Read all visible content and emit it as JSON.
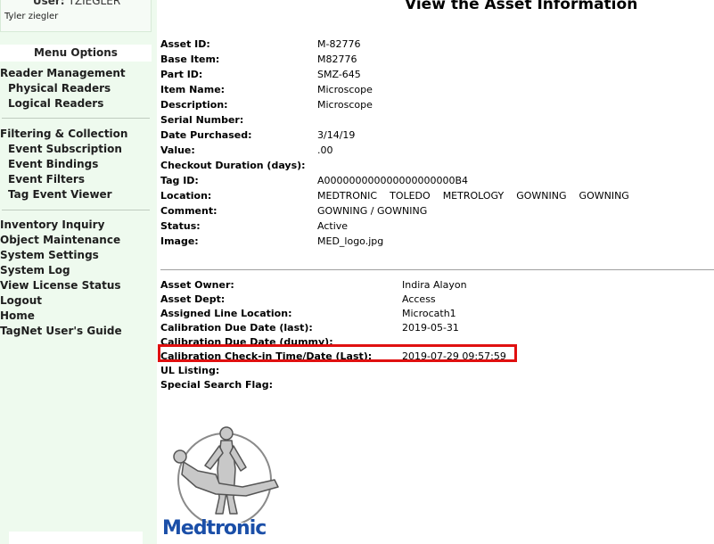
{
  "sidebar": {
    "user_label": "User:",
    "user_value": "TZIEGLER",
    "user_full_name": "Tyler ziegler",
    "menu_title": "Menu Options",
    "group1": [
      {
        "label": "Reader Management",
        "sub": false
      },
      {
        "label": "Physical Readers",
        "sub": true
      },
      {
        "label": "Logical Readers",
        "sub": true
      }
    ],
    "group2": [
      {
        "label": "Filtering & Collection",
        "sub": false
      },
      {
        "label": "Event Subscription",
        "sub": true
      },
      {
        "label": "Event Bindings",
        "sub": true
      },
      {
        "label": "Event Filters",
        "sub": true
      },
      {
        "label": "Tag Event Viewer",
        "sub": true
      }
    ],
    "group3": [
      {
        "label": "Inventory Inquiry"
      },
      {
        "label": "Object Maintenance"
      },
      {
        "label": "System Settings"
      },
      {
        "label": "System Log"
      },
      {
        "label": "View License Status"
      },
      {
        "label": "Logout"
      },
      {
        "label": "Home"
      },
      {
        "label": "TagNet User's Guide"
      }
    ]
  },
  "main": {
    "title": "View the Asset Information",
    "asset_fields": [
      {
        "label": "Asset ID:",
        "value": "M-82776"
      },
      {
        "label": "Base Item:",
        "value": "M82776"
      },
      {
        "label": "Part ID:",
        "value": "SMZ-645"
      },
      {
        "label": "Item Name:",
        "value": "Microscope"
      },
      {
        "label": "Description:",
        "value": "Microscope"
      },
      {
        "label": "Serial Number:",
        "value": ""
      },
      {
        "label": "Date Purchased:",
        "value": "3/14/19"
      },
      {
        "label": "Value:",
        "value": ".00"
      },
      {
        "label": "Checkout Duration (days):",
        "value": ""
      },
      {
        "label": "Tag ID:",
        "value": "A000000000000000000000B4"
      },
      {
        "label": "Location:",
        "value": "",
        "parts": [
          "MEDTRONIC",
          "TOLEDO",
          "METROLOGY",
          "GOWNING",
          "GOWNING"
        ]
      },
      {
        "label": "Comment:",
        "value": "GOWNING / GOWNING"
      },
      {
        "label": "Status:",
        "value": "Active"
      },
      {
        "label": "Image:",
        "value": "MED_logo.jpg"
      }
    ],
    "owner_fields": [
      {
        "label": "Asset Owner:",
        "value": "Indira Alayon"
      },
      {
        "label": "Asset Dept:",
        "value": "Access"
      },
      {
        "label": "Assigned Line Location:",
        "value": "Microcath1"
      },
      {
        "label": "Calibration Due Date (last):",
        "value": "2019-05-31"
      },
      {
        "label": "Calibration Due Date (dummy):",
        "value": ""
      },
      {
        "label": "Calibration Check-in Time/Date (Last):",
        "value": "2019-07-29 09:57:59"
      },
      {
        "label": "UL Listing:",
        "value": ""
      },
      {
        "label": "Special Search Flag:",
        "value": ""
      }
    ],
    "logo_text": "Medtronic"
  },
  "colors": {
    "sidebar_bg": "#eefaee",
    "highlight_border": "#e01010",
    "brand_blue": "#1b4fa8"
  }
}
